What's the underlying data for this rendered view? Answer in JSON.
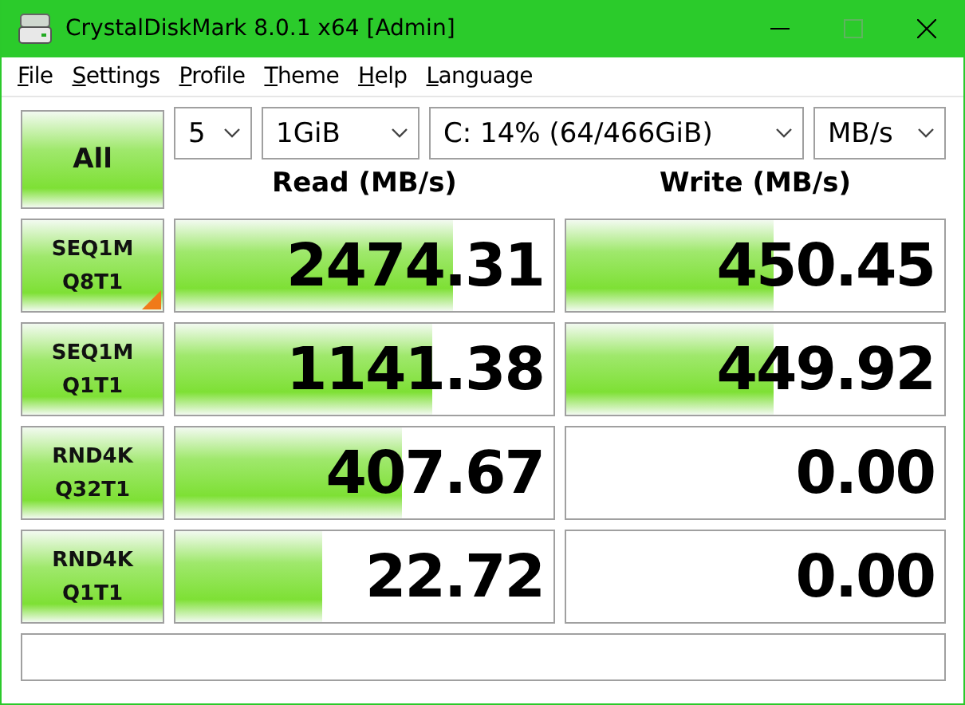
{
  "window": {
    "title": "CrystalDiskMark 8.0.1 x64 [Admin]"
  },
  "menu": [
    "File",
    "Settings",
    "Profile",
    "Theme",
    "Help",
    "Language"
  ],
  "all_button": "All",
  "selectors": [
    {
      "value": "5",
      "kind": "count"
    },
    {
      "value": "1GiB",
      "kind": "size"
    },
    {
      "value": "C: 14% (64/466GiB)",
      "kind": "drive"
    },
    {
      "value": "MB/s",
      "kind": "unit"
    }
  ],
  "columns": [
    "Read (MB/s)",
    "Write (MB/s)"
  ],
  "tests": [
    {
      "line1": "SEQ1M",
      "line2": "Q8T1",
      "flagged": true,
      "read": {
        "value": "2474.31",
        "level": 0.735
      },
      "write": {
        "value": "450.45",
        "level": 0.55
      }
    },
    {
      "line1": "SEQ1M",
      "line2": "Q1T1",
      "flagged": false,
      "read": {
        "value": "1141.38",
        "level": 0.68
      },
      "write": {
        "value": "449.92",
        "level": 0.55
      }
    },
    {
      "line1": "RND4K",
      "line2": "Q32T1",
      "flagged": false,
      "read": {
        "value": "407.67",
        "level": 0.6
      },
      "write": {
        "value": "0.00"
      }
    },
    {
      "line1": "RND4K",
      "line2": "Q1T1",
      "flagged": false,
      "read": {
        "value": "22.72",
        "level": 0.39
      },
      "write": {
        "value": "0.00"
      }
    }
  ]
}
